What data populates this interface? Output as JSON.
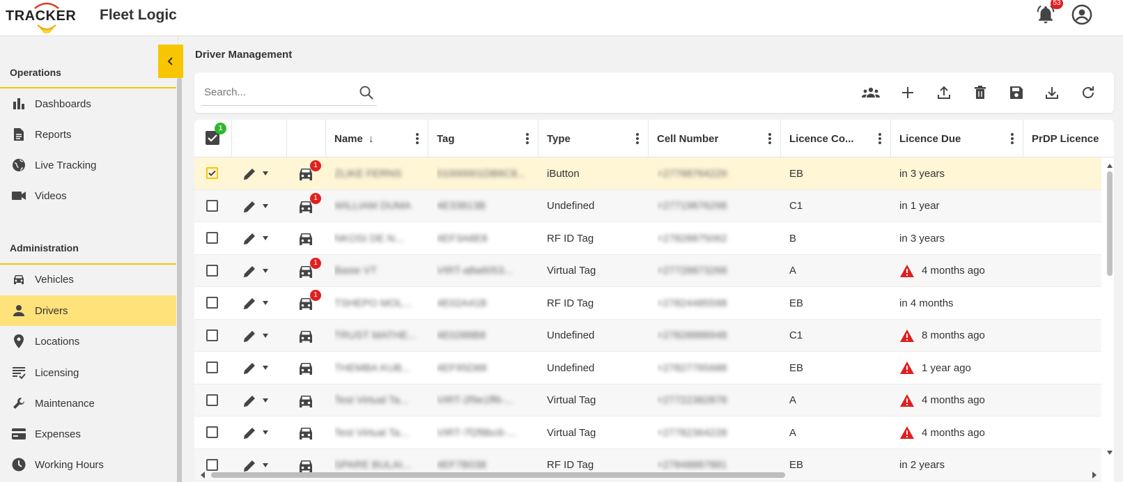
{
  "header": {
    "logo_tracker": "TRACKER",
    "logo_product": "Fleet Logic",
    "notifications_count": "53"
  },
  "sidebar": {
    "operations_title": "Operations",
    "operations": [
      {
        "label": "Dashboards",
        "icon": "bar-chart-icon"
      },
      {
        "label": "Reports",
        "icon": "document-icon"
      },
      {
        "label": "Live Tracking",
        "icon": "globe-icon"
      },
      {
        "label": "Videos",
        "icon": "video-camera-icon"
      }
    ],
    "administration_title": "Administration",
    "administration": [
      {
        "label": "Vehicles",
        "icon": "car-icon"
      },
      {
        "label": "Drivers",
        "icon": "person-icon",
        "active": true
      },
      {
        "label": "Locations",
        "icon": "location-pin-icon"
      },
      {
        "label": "Licensing",
        "icon": "list-check-icon"
      },
      {
        "label": "Maintenance",
        "icon": "wrench-icon"
      },
      {
        "label": "Expenses",
        "icon": "card-icon"
      },
      {
        "label": "Working Hours",
        "icon": "clock-icon"
      }
    ],
    "accent_color": "#f5c500"
  },
  "main": {
    "title": "Driver Management",
    "search_placeholder": "Search...",
    "toolbar_actions": [
      "group-icon",
      "add-icon",
      "upload-icon",
      "delete-icon",
      "save-icon",
      "download-icon",
      "refresh-icon"
    ]
  },
  "grid": {
    "selected_count": "1",
    "columns": [
      "Name",
      "Tag",
      "Type",
      "Cell Number",
      "Licence Co...",
      "Licence Due",
      "PrDP Licence"
    ],
    "sort_indicator": "↓",
    "rows": [
      {
        "name": "ZLIKE FERNS",
        "tag": "01000001DB6C8...",
        "type": "iButton",
        "cell": "+27798764229",
        "licence_code": "EB",
        "licence_due": "in 3 years",
        "warning": false,
        "selected": true,
        "alerts": "1"
      },
      {
        "name": "WILLIAM DUMA",
        "tag": "4E33813B",
        "type": "Undefined",
        "cell": "+27719876298",
        "licence_code": "C1",
        "licence_due": "in 1 year",
        "warning": false,
        "selected": false,
        "alerts": "1"
      },
      {
        "name": "NKOSI DE N...",
        "tag": "4EF3A8E8",
        "type": "RF ID Tag",
        "cell": "+27828875062",
        "licence_code": "B",
        "licence_due": "in 3 years",
        "warning": false,
        "selected": false,
        "alerts": ""
      },
      {
        "name": "Basie VT",
        "tag": "VIRT-a8a6053...",
        "type": "Virtual Tag",
        "cell": "+27728873268",
        "licence_code": "A",
        "licence_due": "4 months ago",
        "warning": true,
        "selected": false,
        "alerts": "1"
      },
      {
        "name": "TSHEPO MOL...",
        "tag": "4E02A41B",
        "type": "RF ID Tag",
        "cell": "+27824485598",
        "licence_code": "EB",
        "licence_due": "in 4 months",
        "warning": false,
        "selected": false,
        "alerts": "1"
      },
      {
        "name": "TRUST MATHE...",
        "tag": "4E0288B8",
        "type": "Undefined",
        "cell": "+27828888948",
        "licence_code": "C1",
        "licence_due": "8 months ago",
        "warning": true,
        "selected": false,
        "alerts": ""
      },
      {
        "name": "THEMBA KUB...",
        "tag": "4EF95D88",
        "type": "Undefined",
        "cell": "+27827765688",
        "licence_code": "EB",
        "licence_due": "1 year ago",
        "warning": true,
        "selected": false,
        "alerts": ""
      },
      {
        "name": "Test Virtual Ta...",
        "tag": "VIRT-2f9e1ff6-...",
        "type": "Virtual Tag",
        "cell": "+27722382878",
        "licence_code": "A",
        "licence_due": "4 months ago",
        "warning": true,
        "selected": false,
        "alerts": ""
      },
      {
        "name": "Test Virtual Ta...",
        "tag": "VIRT-7f2f8bc6-...",
        "type": "Virtual Tag",
        "cell": "+27782364228",
        "licence_code": "A",
        "licence_due": "4 months ago",
        "warning": true,
        "selected": false,
        "alerts": ""
      },
      {
        "name": "SPARE BULAI...",
        "tag": "4EF7B038",
        "type": "RF ID Tag",
        "cell": "+27848887881",
        "licence_code": "EB",
        "licence_due": "in 2 years",
        "warning": false,
        "selected": false,
        "alerts": ""
      }
    ]
  }
}
